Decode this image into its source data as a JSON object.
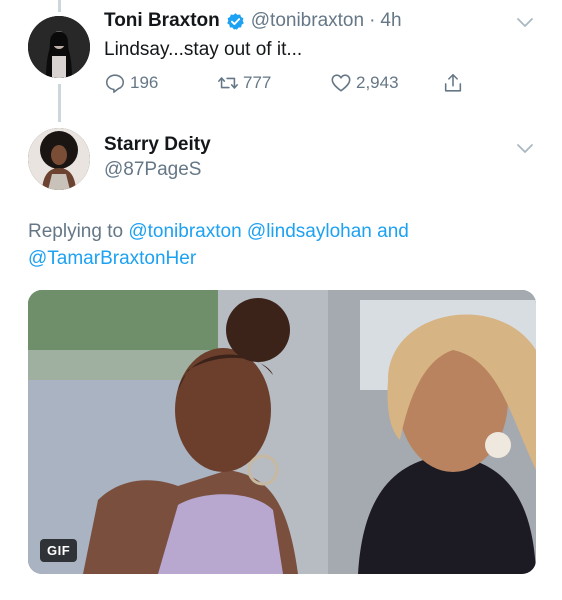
{
  "tweet_1": {
    "name": "Toni Braxton",
    "handle": "@tonibraxton",
    "separator": "·",
    "time": "4h",
    "text": "Lindsay...stay out of it...",
    "verified": true,
    "actions": {
      "reply_count": "196",
      "retweet_count": "777",
      "like_count": "2,943"
    }
  },
  "tweet_2": {
    "name": "Starry Deity",
    "handle": "@87PageS",
    "replying": {
      "prefix": "Replying to",
      "mention_1": "@tonibraxton",
      "mention_2": "@lindsaylohan",
      "conjunction": "and",
      "mention_3": "@TamarBraxtonHer"
    },
    "media": {
      "badge": "GIF"
    }
  },
  "colors": {
    "link": "#1da1f2",
    "secondary_text": "#657786",
    "verified": "#1da1f2",
    "thread_line": "#ccd6dd"
  },
  "icons": {
    "reply": "reply-icon",
    "retweet": "retweet-icon",
    "like": "heart-icon",
    "share": "share-icon",
    "verified": "verified-badge-icon",
    "chevron": "chevron-down-icon"
  }
}
